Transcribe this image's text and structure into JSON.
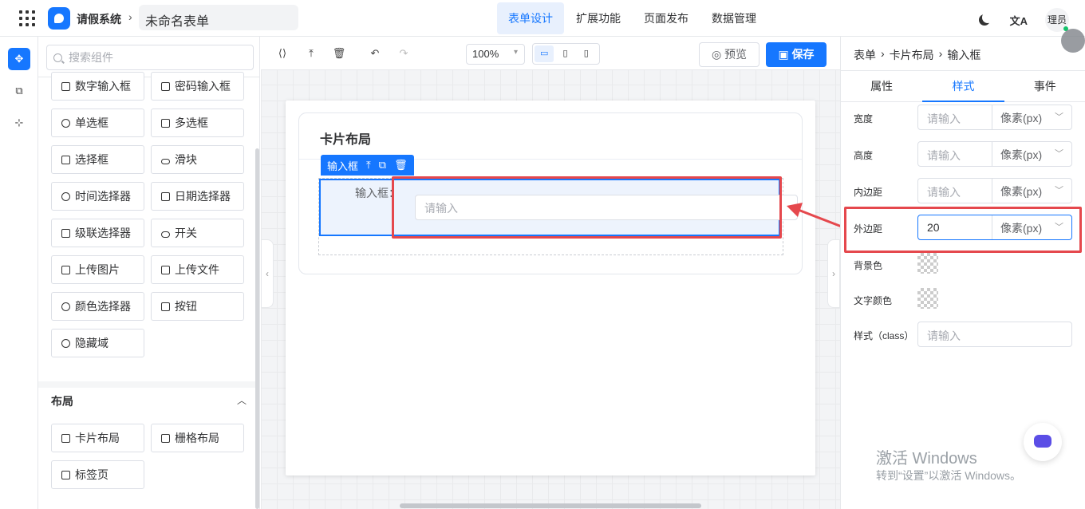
{
  "app": {
    "name": "请假系统",
    "form_title": "未命名表单"
  },
  "nav": {
    "tabs": [
      "表单设计",
      "扩展功能",
      "页面发布",
      "数据管理"
    ],
    "active": 0
  },
  "user": {
    "avatar_text": "理员",
    "translate_icon": "文A"
  },
  "palette": {
    "search_placeholder": "搜索组件",
    "items": [
      {
        "label": "数字输入框",
        "icon": "number-icon"
      },
      {
        "label": "密码输入框",
        "icon": "lock-icon"
      },
      {
        "label": "单选框",
        "icon": "radio-icon"
      },
      {
        "label": "多选框",
        "icon": "checkbox-icon"
      },
      {
        "label": "选择框",
        "icon": "select-icon"
      },
      {
        "label": "滑块",
        "icon": "slider-icon"
      },
      {
        "label": "时间选择器",
        "icon": "clock-icon"
      },
      {
        "label": "日期选择器",
        "icon": "calendar-icon"
      },
      {
        "label": "级联选择器",
        "icon": "cascader-icon"
      },
      {
        "label": "开关",
        "icon": "switch-icon"
      },
      {
        "label": "上传图片",
        "icon": "image-icon"
      },
      {
        "label": "上传文件",
        "icon": "upload-icon"
      },
      {
        "label": "颜色选择器",
        "icon": "palette-icon"
      },
      {
        "label": "按钮",
        "icon": "button-icon"
      },
      {
        "label": "隐藏域",
        "icon": "eye-off-icon"
      }
    ],
    "layout_section": "布局",
    "layout_items": [
      {
        "label": "卡片布局",
        "icon": "card-icon"
      },
      {
        "label": "栅格布局",
        "icon": "grid-icon"
      },
      {
        "label": "标签页",
        "icon": "tabs-icon"
      }
    ]
  },
  "toolbar": {
    "zoom": "100%",
    "preview": "预览",
    "save": "保存"
  },
  "canvas": {
    "card_title": "卡片布局",
    "selected_tag": "输入框",
    "input_label": "输入框：",
    "input_placeholder": "请输入"
  },
  "properties": {
    "breadcrumb": [
      "表单",
      "卡片布局",
      "输入框"
    ],
    "tabs": [
      "属性",
      "样式",
      "事件"
    ],
    "active_tab": 1,
    "rows": [
      {
        "label": "宽度",
        "value": "",
        "placeholder": "请输入",
        "unit": "像素(px)"
      },
      {
        "label": "高度",
        "value": "",
        "placeholder": "请输入",
        "unit": "像素(px)"
      },
      {
        "label": "内边距",
        "value": "",
        "placeholder": "请输入",
        "unit": "像素(px)"
      },
      {
        "label": "外边距",
        "value": "20",
        "placeholder": "",
        "unit": "像素(px)"
      }
    ],
    "bg_label": "背景色",
    "text_color_label": "文字颜色",
    "class_label": "样式（class）",
    "class_placeholder": "请输入"
  },
  "watermark": {
    "line1": "激活 Windows",
    "line2": "转到“设置”以激活 Windows。"
  },
  "colors": {
    "accent": "#1677ff",
    "highlight": "#e5484d"
  }
}
